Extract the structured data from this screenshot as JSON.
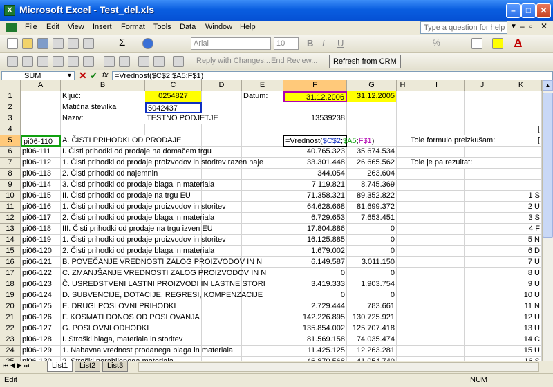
{
  "window": {
    "title": "Microsoft Excel - Test_del.xls",
    "app_badge": "X"
  },
  "menu": [
    "File",
    "Edit",
    "View",
    "Insert",
    "Format",
    "Tools",
    "Data",
    "Window",
    "Help"
  ],
  "help_placeholder": "Type a question for help",
  "toolbar": {
    "font": "Arial",
    "size": "10",
    "bold": "B",
    "italic": "I",
    "underline": "U",
    "currency": "%",
    "autosum": "Σ",
    "reply_changes": "Reply with Changes...",
    "end_review": "End Review...",
    "refresh_crm": "Refresh from CRM"
  },
  "formula_bar": {
    "name_box": "SUM",
    "fx": "fx",
    "formula": "=Vrednost($C$2;$A5;F$1)"
  },
  "columns": [
    "A",
    "B",
    "C",
    "D",
    "E",
    "F",
    "G",
    "H",
    "I",
    "J",
    "K"
  ],
  "rows": [
    {
      "n": "1",
      "A": "",
      "B": "Ključ:",
      "C": "0254827",
      "D": "",
      "E": "Datum:",
      "F": "31.12.2006",
      "G": "31.12.2005",
      "I": "",
      "K": ""
    },
    {
      "n": "2",
      "A": "",
      "B": "Matična številka",
      "C": "5042437",
      "D": "",
      "E": "",
      "F": "",
      "G": "",
      "I": "",
      "K": ""
    },
    {
      "n": "3",
      "A": "",
      "B": "Naziv:",
      "C": "TESTNO PODJETJE",
      "D": "",
      "E": "",
      "F": "13539238",
      "G": "",
      "I": "",
      "K": ""
    },
    {
      "n": "4",
      "A": "",
      "B": "",
      "C": "",
      "D": "",
      "E": "",
      "F": "",
      "G": "",
      "I": "",
      "K": "["
    },
    {
      "n": "5",
      "A": "pi06-110",
      "B": "A. ČISTI PRIHODKI OD PRODAJE",
      "F": "=Vrednost($C$2;$A5;F$1)",
      "G": "",
      "I": "Tole formulo preizkušam:",
      "K": "["
    },
    {
      "n": "6",
      "A": "pi06-111",
      "B": "I. Čisti prihodki od prodaje na domačem trgu",
      "F": "40.765.323",
      "G": "35.674.534",
      "I": "",
      "K": ""
    },
    {
      "n": "7",
      "A": "pi06-112",
      "B": "1. Čisti prihodki od prodaje proizvodov in storitev razen naje",
      "F": "33.301.448",
      "G": "26.665.562",
      "I": "Tole je pa rezultat:",
      "K": ""
    },
    {
      "n": "8",
      "A": "pi06-113",
      "B": "2. Čisti prihodki od najemnin",
      "F": "344.054",
      "G": "263.604",
      "I": "",
      "K": ""
    },
    {
      "n": "9",
      "A": "pi06-114",
      "B": "3. Čisti prihodki od prodaje blaga in materiala",
      "F": "7.119.821",
      "G": "8.745.369",
      "I": "",
      "K": ""
    },
    {
      "n": "10",
      "A": "pi06-115",
      "B": "II. Čisti prihodki od prodaje na trgu EU",
      "F": "71.358.321",
      "G": "89.352.822",
      "I": "",
      "K": "1 S"
    },
    {
      "n": "11",
      "A": "pi06-116",
      "B": "1. Čisti prihodki od prodaje proizvodov in storitev",
      "F": "64.628.668",
      "G": "81.699.372",
      "I": "",
      "K": "2 U"
    },
    {
      "n": "12",
      "A": "pi06-117",
      "B": "2. Čisti prihodki od prodaje blaga in materiala",
      "F": "6.729.653",
      "G": "7.653.451",
      "I": "",
      "K": "3 S"
    },
    {
      "n": "13",
      "A": "pi06-118",
      "B": "III. Čisti prihodki od prodaje na trgu izven EU",
      "F": "17.804.886",
      "G": "0",
      "I": "",
      "K": "4 F"
    },
    {
      "n": "14",
      "A": "pi06-119",
      "B": "1. Čisti prihodki od prodaje proizvodov in storitev",
      "F": "16.125.885",
      "G": "0",
      "I": "",
      "K": "5 N"
    },
    {
      "n": "15",
      "A": "pi06-120",
      "B": "2. Čisti prihodki od prodaje blaga in materiala",
      "F": "1.679.002",
      "G": "0",
      "I": "",
      "K": "6 D"
    },
    {
      "n": "16",
      "A": "pi06-121",
      "B": "B. POVEČANJE VREDNOSTI ZALOG PROIZVODOV IN N",
      "F": "6.149.587",
      "G": "3.011.150",
      "I": "",
      "K": "7 U"
    },
    {
      "n": "17",
      "A": "pi06-122",
      "B": "C. ZMANJŠANJE VREDNOSTI ZALOG PROIZVODOV IN N",
      "F": "0",
      "G": "0",
      "I": "",
      "K": "8 U"
    },
    {
      "n": "18",
      "A": "pi06-123",
      "B": "Č. USREDSTVENI LASTNI PROIZVODI IN LASTNE STORI",
      "F": "3.419.333",
      "G": "1.903.754",
      "I": "",
      "K": "9 U"
    },
    {
      "n": "19",
      "A": "pi06-124",
      "B": "D. SUBVENCIJE, DOTACIJE, REGRESI, KOMPENZACIJE",
      "F": "0",
      "G": "0",
      "I": "",
      "K": "10 U"
    },
    {
      "n": "20",
      "A": "pi06-125",
      "B": "E. DRUGI POSLOVNI PRIHODKI",
      "F": "2.729.444",
      "G": "783.661",
      "I": "",
      "K": "11 N"
    },
    {
      "n": "21",
      "A": "pi06-126",
      "B": "F. KOSMATI DONOS OD POSLOVANJA",
      "F": "142.226.895",
      "G": "130.725.921",
      "I": "",
      "K": "12 U"
    },
    {
      "n": "22",
      "A": "pi06-127",
      "B": "G. POSLOVNI ODHODKI",
      "F": "135.854.002",
      "G": "125.707.418",
      "I": "",
      "K": "13 U"
    },
    {
      "n": "23",
      "A": "pi06-128",
      "B": "I. Stroški blaga, materiala in storitev",
      "F": "81.569.158",
      "G": "74.035.474",
      "I": "",
      "K": "14 C"
    },
    {
      "n": "24",
      "A": "pi06-129",
      "B": "1. Nabavna vrednost prodanega blaga in materiala",
      "F": "11.425.125",
      "G": "12.263.281",
      "I": "",
      "K": "15 U"
    },
    {
      "n": "25",
      "A": "pi06-130",
      "B": "2. Stroški porabljenega materiala",
      "F": "46.870.568",
      "G": "41.054.740",
      "I": "",
      "K": "16 S"
    }
  ],
  "sheets": [
    "List1",
    "List2",
    "List3"
  ],
  "status": {
    "mode": "Edit",
    "num": "NUM"
  },
  "colors": {
    "yellow": "#ffff00",
    "selection_hdr": "#ffc97a",
    "titlebar": "#0a5ee0"
  }
}
